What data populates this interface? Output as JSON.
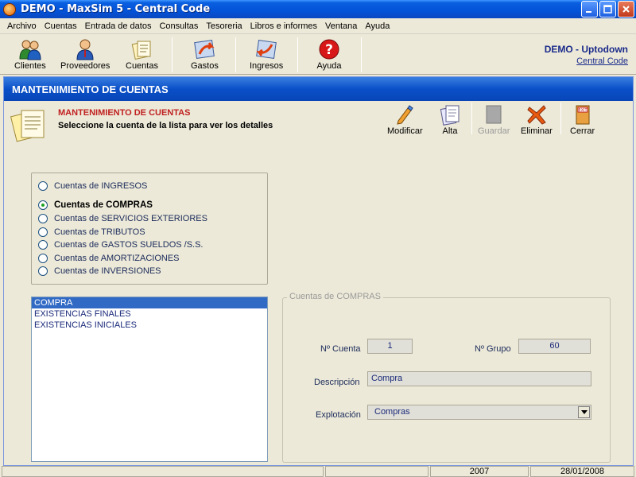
{
  "window": {
    "title": "DEMO - MaxSim 5 - Central Code"
  },
  "menu": {
    "items": [
      "Archivo",
      "Cuentas",
      "Entrada de datos",
      "Consultas",
      "Tesoreria",
      "Libros e informes",
      "Ventana",
      "Ayuda"
    ]
  },
  "toolbar": {
    "buttons": [
      {
        "label": "Clientes",
        "icon": "clients-icon"
      },
      {
        "label": "Proveedores",
        "icon": "supplier-icon"
      },
      {
        "label": "Cuentas",
        "icon": "accounts-icon"
      },
      {
        "label": "Gastos",
        "icon": "expenses-icon"
      },
      {
        "label": "Ingresos",
        "icon": "income-icon"
      },
      {
        "label": "Ayuda",
        "icon": "help-icon"
      }
    ],
    "company": "DEMO - Uptodown",
    "company_link": "Central Code"
  },
  "form": {
    "window_title": "MANTENIMIENTO DE CUENTAS",
    "header_title": "MANTENIMIENTO DE CUENTAS",
    "header_subtitle": "Seleccione la cuenta de la lista para ver los detalles",
    "actions": [
      {
        "label": "Modificar",
        "icon": "edit-pencil-icon",
        "enabled": true
      },
      {
        "label": "Alta",
        "icon": "new-document-icon",
        "enabled": true
      },
      {
        "label": "Guardar",
        "icon": "save-icon",
        "enabled": false
      },
      {
        "label": "Eliminar",
        "icon": "delete-icon",
        "enabled": true
      },
      {
        "label": "Cerrar",
        "icon": "exit-icon",
        "enabled": true
      }
    ],
    "account_types": [
      {
        "label": "Cuentas de INGRESOS",
        "selected": false
      },
      {
        "label": "Cuentas de COMPRAS",
        "selected": true
      },
      {
        "label": "Cuentas de SERVICIOS EXTERIORES",
        "selected": false
      },
      {
        "label": "Cuentas de TRIBUTOS",
        "selected": false
      },
      {
        "label": "Cuentas de GASTOS SUELDOS /S.S.",
        "selected": false
      },
      {
        "label": "Cuentas de AMORTIZACIONES",
        "selected": false
      },
      {
        "label": "Cuentas de INVERSIONES",
        "selected": false
      }
    ],
    "accounts_list": [
      "COMPRA",
      "EXISTENCIAS FINALES",
      "EXISTENCIAS INICIALES"
    ],
    "selected_account_index": 0,
    "details": {
      "legend": "Cuentas de COMPRAS",
      "n_cuenta_label": "Nº Cuenta",
      "n_cuenta_value": "1",
      "n_grupo_label": "Nº Grupo",
      "n_grupo_value": "60",
      "descripcion_label": "Descripción",
      "descripcion_value": "Compra",
      "explotacion_label": "Explotación",
      "explotacion_value": "Compras"
    }
  },
  "status": {
    "year": "2007",
    "date": "28/01/2008"
  },
  "colors": {
    "titlebar": "#0453d8",
    "header_red": "#c02020",
    "selection": "#316ac5"
  }
}
